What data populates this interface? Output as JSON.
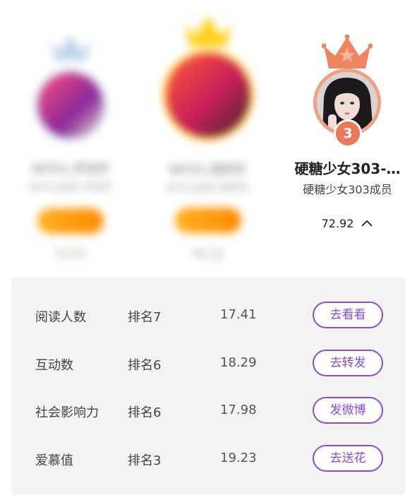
{
  "candidates": [
    {
      "position": "left",
      "name": "INTO1-尹浩宇",
      "group": "INTO1成员-尹浩宇",
      "score": "73.01",
      "crown_color": "#b9d3e6",
      "ring_color": "#d8e6f0",
      "blurred": true
    },
    {
      "position": "middle",
      "name": "INTO1-周柯宇",
      "group": "INTO1成员-周柯宇",
      "score": "76.22",
      "crown_color": "#ffd21f",
      "ring_color": "#ffd64a",
      "blurred": true
    },
    {
      "position": "right",
      "rank": "3",
      "name": "硬糖少女303-…",
      "group": "硬糖少女303成员",
      "score": "72.92",
      "expand_icon": "chevron-up-icon",
      "crown_color": "#ef8460",
      "ring_color": "#f0a184",
      "blurred": false
    }
  ],
  "details": [
    {
      "label": "阅读人数",
      "rank": "排名7",
      "value": "17.41",
      "action": "去看看"
    },
    {
      "label": "互动数",
      "rank": "排名6",
      "value": "18.29",
      "action": "去转发"
    },
    {
      "label": "社会影响力",
      "rank": "排名6",
      "value": "17.98",
      "action": "发微博"
    },
    {
      "label": "爱慕值",
      "rank": "排名3",
      "value": "19.23",
      "action": "去送花"
    }
  ],
  "colors": {
    "accent": "#8b4bd0",
    "panel_bg": "#f3f3f3",
    "vote_pill": "#ff9a10"
  }
}
